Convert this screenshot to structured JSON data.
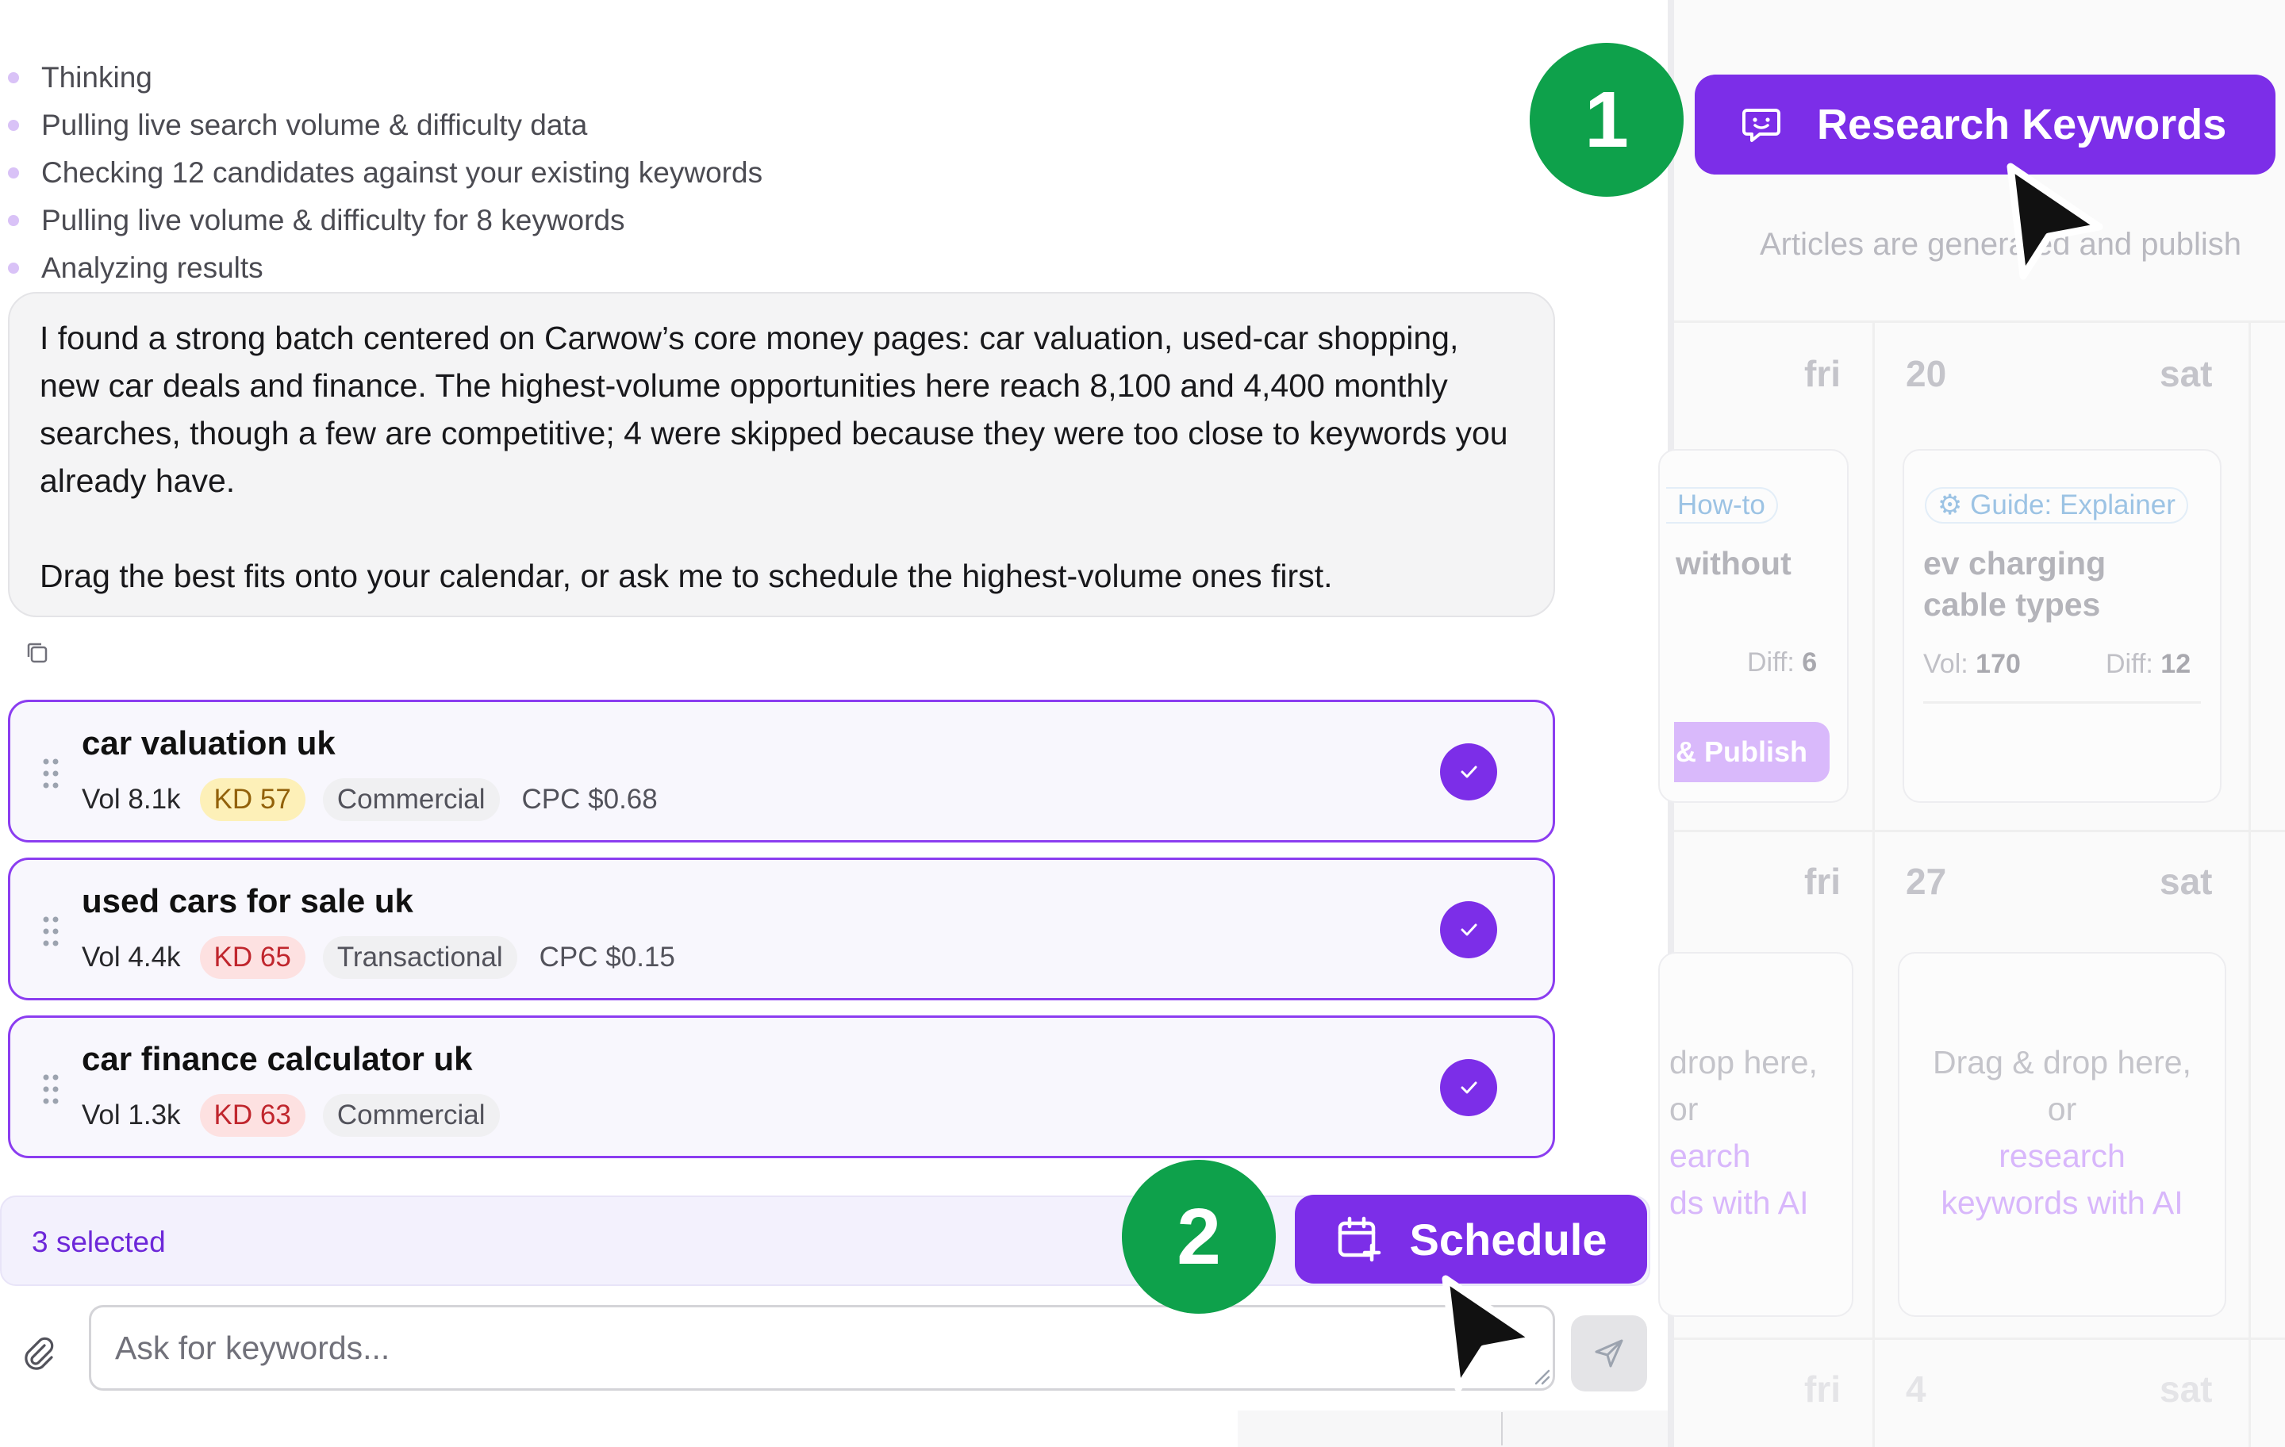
{
  "steps": [
    "Thinking",
    "Pulling live search volume & difficulty data",
    "Checking 12 candidates against your existing keywords",
    "Pulling live volume & difficulty for 8 keywords",
    "Analyzing results"
  ],
  "message": {
    "paragraph1": "I found a strong batch centered on Carwow’s core money pages: car valuation, used-car shopping, new car deals and finance. The highest-volume opportunities here reach 8,100 and 4,400 monthly searches, though a few are competitive; 4 were skipped because they were too close to keywords you already have.",
    "paragraph2": "Drag the best fits onto your calendar, or ask me to schedule the highest-volume ones first."
  },
  "keywords": [
    {
      "title": "car valuation uk",
      "vol": "Vol 8.1k",
      "kd": "KD 57",
      "intent": "Commercial",
      "cpc": "CPC $0.68"
    },
    {
      "title": "used cars for sale uk",
      "vol": "Vol 4.4k",
      "kd": "KD 65",
      "intent": "Transactional",
      "cpc": "CPC $0.15"
    },
    {
      "title": "car finance calculator uk",
      "vol": "Vol 1.3k",
      "kd": "KD 63",
      "intent": "Commercial"
    }
  ],
  "selection": {
    "text": "3 selected",
    "schedule_label": "Schedule"
  },
  "input": {
    "placeholder": "Ask for keywords..."
  },
  "calendar": {
    "research_label": "Research Keywords",
    "subtitle": "Articles are generated and publish",
    "row1": {
      "day_left": "fri",
      "date": "20",
      "day_right": "sat"
    },
    "row2": {
      "day_left": "fri",
      "date": "27",
      "day_right": "sat"
    },
    "row3": {
      "day_left": "fri",
      "date": "4",
      "day_right": "sat"
    },
    "card_left": {
      "tag": "How-to",
      "title": "without",
      "diff_label": "Diff:",
      "diff_value": "6",
      "publish": "& Publish"
    },
    "card_right": {
      "tag": "Guide: Explainer",
      "title_line1": "ev charging",
      "title_line2": "cable types",
      "vol_label": "Vol:",
      "vol_value": "170",
      "diff_label": "Diff:",
      "diff_value": "12"
    },
    "drop_left": {
      "line1": "drop here,",
      "line2": "or",
      "line3": "earch",
      "line4": "ds with AI"
    },
    "drop_right": {
      "line1": "Drag & drop here,",
      "line2": "or",
      "line3": "research",
      "line4": "keywords with AI"
    }
  },
  "annotations": {
    "badge1": "1",
    "badge2": "2"
  },
  "colors": {
    "accent": "#7c2ee8",
    "badge": "#0ea14b",
    "kd_yellow": "#fdf0b8",
    "kd_red": "#fde1e1"
  }
}
